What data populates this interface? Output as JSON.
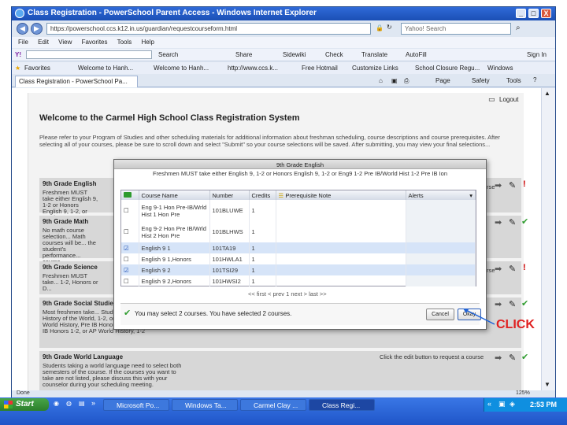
{
  "window": {
    "title": "Class Registration - PowerSchool Parent Access - Windows Internet Explorer",
    "min": "_",
    "max": "□",
    "close": "X"
  },
  "address": {
    "url": "https://powerschool.ccs.k12.in.us/guardian/requestcourseform.html",
    "search_placeholder": "Yahoo! Search"
  },
  "menu": [
    "File",
    "Edit",
    "View",
    "Favorites",
    "Tools",
    "Help"
  ],
  "toolbar": {
    "search_label": "Search",
    "share": "Share",
    "sidewiki": "Sidewiki",
    "check": "Check",
    "translate": "Translate",
    "autofill": "AutoFill",
    "signin": "Sign In"
  },
  "favorites": {
    "label": "Favorites",
    "items": [
      "Welcome to Hanh...",
      "Welcome to Hanh...",
      "http://www.ccs.k...",
      "Free Hotmail",
      "Customize Links",
      "School Closure Regu...",
      "Windows"
    ]
  },
  "tabs": {
    "active": "Class Registration - PowerSchool Pa...",
    "tools": [
      "Page",
      "Safety",
      "Tools"
    ]
  },
  "page": {
    "logout": "Logout",
    "heading": "Welcome to the Carmel High School Class Registration System",
    "intro": "Please refer to your Program of Studies and other scheduling materials for additional information about freshman scheduling, course descriptions and course prerequisites. After selecting all of your courses, please be sure to scroll down and select \"Submit\" so your course selections will be saved. After submitting, you may view your final selections..."
  },
  "sections": [
    {
      "title": "9th Grade English",
      "body": "Freshmen MUST take either English 9, 1-2 or Honors English 9, 1-2, or Eng/9 1-2 Pre IB/World Hist 1-2 Pre IB Ion",
      "note": "course"
    },
    {
      "title": "9th Grade Math",
      "body": "No math course selection... Math courses will be... the student's performance... course.",
      "note": ""
    },
    {
      "title": "9th Grade Science",
      "body": "Freshmen MUST take... 1-2, Honors or D...",
      "note": "course"
    },
    {
      "title": "9th Grade Social Studies",
      "body": "Most freshmen take... Students taking ac... Geography History of the World, 1-2, or World History, 1-2, or World History, Pre IB Honors 1-2 / English 9, 1-2 Pre IB Honors 1-2, or AP World History, 1-2",
      "note": ""
    },
    {
      "title": "9th Grade World Language",
      "body": "Students taking a world language need to select both semesters of the course. If the courses you want to take are not listed, please discuss this with your counselor during your scheduling meeting.",
      "note": "Click the edit button to request a course"
    }
  ],
  "modal": {
    "title": "9th Grade English",
    "note": "Freshmen MUST take either English 9, 1-2 or Honors English 9, 1-2 or Eng9 1-2 Pre IB/World Hist 1-2 Pre IB Ion",
    "columns": [
      "Course Name",
      "Number",
      "Credits",
      "Prerequisite Note",
      "Alerts"
    ],
    "rows": [
      {
        "name": "Eng 9-1 Hon Pre-IB/Wrld Hist 1 Hon Pre",
        "number": "101BLUWE",
        "credits": "1",
        "checked": false
      },
      {
        "name": "Eng 9-2 Hon Pre IB/Wrld Hist 2 Hon Pre",
        "number": "101BLHWS",
        "credits": "1",
        "checked": false
      },
      {
        "name": "English 9 1",
        "number": "101TA19",
        "credits": "1",
        "checked": true
      },
      {
        "name": "English 9 1,Honors",
        "number": "101HWLA1",
        "credits": "1",
        "checked": false
      },
      {
        "name": "English 9 2",
        "number": "101TSI29",
        "credits": "1",
        "checked": true
      },
      {
        "name": "English 9 2,Honors",
        "number": "101HWSI2",
        "credits": "1",
        "checked": false
      }
    ],
    "pager": "<< first  < prev  1  next >  last >>",
    "status": "You may select 2 courses. You have selected 2 courses.",
    "cancel": "Cancel",
    "okay": "Okay"
  },
  "annotation": "CLICK",
  "statusbar": {
    "left": "Done",
    "zoom": "125%"
  },
  "taskbar": {
    "start": "Start",
    "buttons": [
      "Microsoft Po...",
      "Windows Ta...",
      "Carmel Clay ...",
      "Class Regi..."
    ],
    "time": "2:53 PM"
  },
  "colors": {
    "accent": "#1b4fb5",
    "check": "#2e9b2e",
    "alert": "#cc0000",
    "annotation": "#e02020"
  }
}
